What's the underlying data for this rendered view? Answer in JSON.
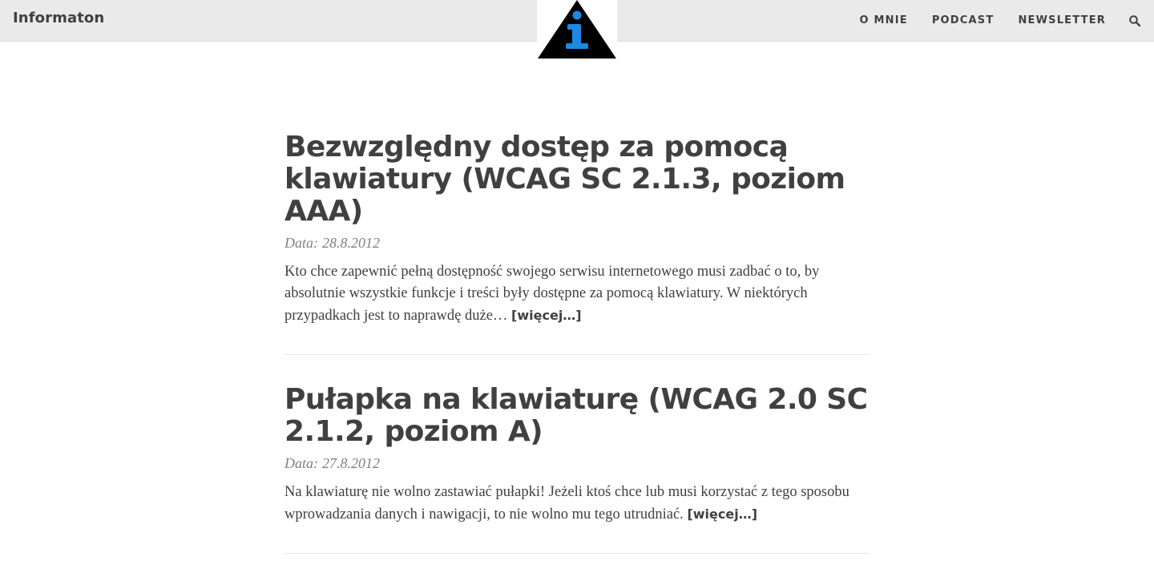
{
  "header": {
    "brand": "Informaton",
    "logo_icon": "info-triangle-logo",
    "nav": [
      {
        "label": "O MNIE"
      },
      {
        "label": "PODCAST"
      },
      {
        "label": "NEWSLETTER"
      }
    ],
    "search_icon": "search-icon",
    "colors": {
      "bar_background": "#eaeaea",
      "logo_triangle": "#000000",
      "logo_accent": "#1e88e5"
    }
  },
  "posts": [
    {
      "title": "Bezwzględny dostęp za pomocą klawiatury (WCAG SC 2.1.3, poziom AAA)",
      "date_label": "Data:",
      "date": "28.8.2012",
      "excerpt": "Kto chce zapewnić pełną dostępność swojego serwisu internetowego musi zadbać o to, by absolutnie wszystkie funkcje i treści były dostępne za pomocą klawiatury. W niektórych przypadkach jest to naprawdę duże…",
      "more": "[więcej…]"
    },
    {
      "title": "Pułapka na klawiaturę (WCAG 2.0 SC 2.1.2, poziom A)",
      "date_label": "Data:",
      "date": "27.8.2012",
      "excerpt": "Na klawiaturę nie wolno zastawiać pułapki! Jeżeli ktoś chce lub musi korzystać z tego sposobu wprowadzania danych i nawigacji, to nie wolno mu tego utrudniać.",
      "more": "[więcej…]"
    }
  ]
}
